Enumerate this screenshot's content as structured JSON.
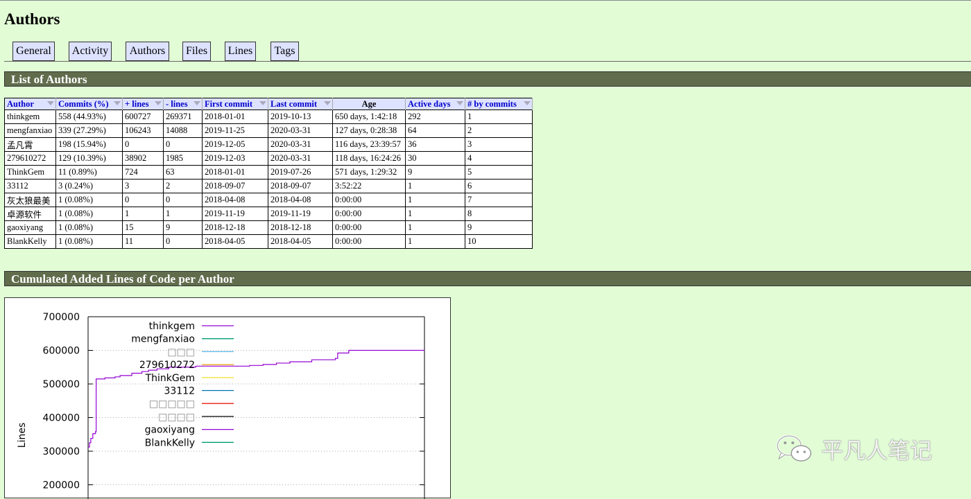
{
  "page": {
    "title": "Authors"
  },
  "nav": [
    "General",
    "Activity",
    "Authors",
    "Files",
    "Lines",
    "Tags"
  ],
  "sections": {
    "list_of_authors": "List of Authors",
    "cumulated": "Cumulated Added Lines of Code per Author"
  },
  "table": {
    "headers": [
      "Author",
      "Commits (%)",
      "+ lines",
      "- lines",
      "First commit",
      "Last commit",
      "Age",
      "Active days",
      "# by commits"
    ],
    "rows": [
      [
        "thinkgem",
        "558 (44.93%)",
        "600727",
        "269371",
        "2018-01-01",
        "2019-10-13",
        "650 days, 1:42:18",
        "292",
        "1"
      ],
      [
        "mengfanxiao",
        "339 (27.29%)",
        "106243",
        "14088",
        "2019-11-25",
        "2020-03-31",
        "127 days, 0:28:38",
        "64",
        "2"
      ],
      [
        "孟凡霄",
        "198 (15.94%)",
        "0",
        "0",
        "2019-12-05",
        "2020-03-31",
        "116 days, 23:39:57",
        "36",
        "3"
      ],
      [
        "279610272",
        "129 (10.39%)",
        "38902",
        "1985",
        "2019-12-03",
        "2020-03-31",
        "118 days, 16:24:26",
        "30",
        "4"
      ],
      [
        "ThinkGem",
        "11 (0.89%)",
        "724",
        "63",
        "2018-01-01",
        "2019-07-26",
        "571 days, 1:29:32",
        "9",
        "5"
      ],
      [
        "33112",
        "3 (0.24%)",
        "3",
        "2",
        "2018-09-07",
        "2018-09-07",
        "3:52:22",
        "1",
        "6"
      ],
      [
        "灰太狼最美",
        "1 (0.08%)",
        "0",
        "0",
        "2018-04-08",
        "2018-04-08",
        "0:00:00",
        "1",
        "7"
      ],
      [
        "卓源软件",
        "1 (0.08%)",
        "1",
        "1",
        "2019-11-19",
        "2019-11-19",
        "0:00:00",
        "1",
        "8"
      ],
      [
        "gaoxiyang",
        "1 (0.08%)",
        "15",
        "9",
        "2018-12-18",
        "2018-12-18",
        "0:00:00",
        "1",
        "9"
      ],
      [
        "BlankKelly",
        "1 (0.08%)",
        "11",
        "0",
        "2018-04-05",
        "2018-04-05",
        "0:00:00",
        "1",
        "10"
      ]
    ]
  },
  "chart_data": {
    "type": "line",
    "title": "",
    "ylabel": "Lines",
    "xlabel": "",
    "ylim": [
      180000,
      700000
    ],
    "yticks": [
      "700000",
      "600000",
      "500000",
      "400000",
      "300000",
      "200000"
    ],
    "grid": true,
    "legend": "top-left inside",
    "series": [
      {
        "name": "thinkgem",
        "color": "#9400d3"
      },
      {
        "name": "mengfanxiao",
        "color": "#009e73"
      },
      {
        "name": "□□□",
        "color": "#56b4e9"
      },
      {
        "name": "279610272",
        "color": "#e69f00"
      },
      {
        "name": "ThinkGem",
        "color": "#f0e442"
      },
      {
        "name": "33112",
        "color": "#0072b2"
      },
      {
        "name": "□□□□□",
        "color": "#e51e10"
      },
      {
        "name": "□□□□",
        "color": "#000000"
      },
      {
        "name": "gaoxiyang",
        "color": "#9400d3"
      },
      {
        "name": "BlankKelly",
        "color": "#009e73"
      }
    ],
    "visible_line": {
      "name": "thinkgem",
      "points": [
        [
          0.0,
          312000
        ],
        [
          0.004,
          325000
        ],
        [
          0.008,
          338000
        ],
        [
          0.014,
          352000
        ],
        [
          0.022,
          358000
        ],
        [
          0.024,
          515000
        ],
        [
          0.05,
          518000
        ],
        [
          0.08,
          521000
        ],
        [
          0.095,
          525000
        ],
        [
          0.13,
          532000
        ],
        [
          0.16,
          537000
        ],
        [
          0.18,
          541000
        ],
        [
          0.205,
          545000
        ],
        [
          0.24,
          550000
        ],
        [
          0.32,
          553000
        ],
        [
          0.48,
          555000
        ],
        [
          0.52,
          558000
        ],
        [
          0.56,
          562000
        ],
        [
          0.6,
          566000
        ],
        [
          0.665,
          572000
        ],
        [
          0.735,
          576000
        ],
        [
          0.742,
          592000
        ],
        [
          0.775,
          600000
        ],
        [
          1.0,
          600000
        ]
      ]
    }
  },
  "watermark": {
    "text": "平凡人笔记"
  }
}
